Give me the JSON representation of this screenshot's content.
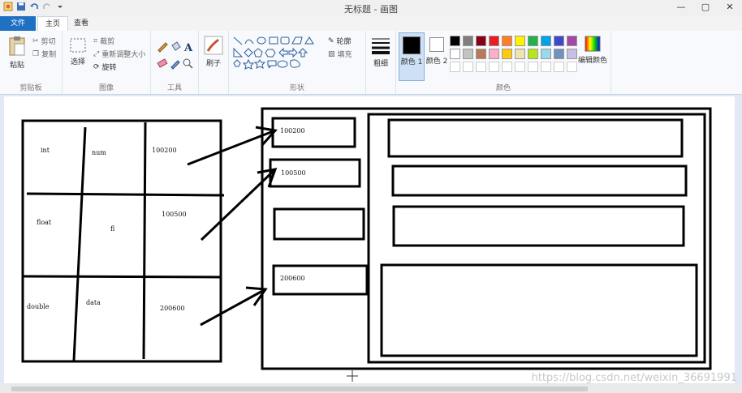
{
  "window": {
    "title": "无标题 - 画图",
    "minimize": "—",
    "maximize": "▢",
    "close": "✕"
  },
  "tabs": {
    "file": "文件",
    "home": "主页",
    "view": "查看"
  },
  "clipboard": {
    "paste": "粘贴",
    "cut": "剪切",
    "copy": "复制",
    "label": "剪贴板"
  },
  "image": {
    "select": "选择",
    "crop": "裁剪",
    "resize": "重新调整大小",
    "rotate": "旋转",
    "label": "图像"
  },
  "tools": {
    "label": "工具"
  },
  "brushes": {
    "label": "刷子"
  },
  "shapes": {
    "outline": "轮廓",
    "fill": "填充",
    "label": "形状"
  },
  "size": {
    "label": "粗细"
  },
  "colors": {
    "color1": "颜色 1",
    "color2": "颜色 2",
    "edit": "编辑颜色",
    "label": "颜色",
    "palette_row1": [
      "#000000",
      "#7f7f7f",
      "#880015",
      "#ed1c24",
      "#ff7f27",
      "#fff200",
      "#22b14c",
      "#00a2e8",
      "#3f48cc",
      "#a349a4"
    ],
    "palette_row2": [
      "#ffffff",
      "#c3c3c3",
      "#b97a57",
      "#ffaec9",
      "#ffc90e",
      "#efe4b0",
      "#b5e61d",
      "#99d9ea",
      "#7092be",
      "#c8bfe7"
    ]
  },
  "drawing": {
    "table": {
      "row1": [
        "int",
        "num",
        "100200"
      ],
      "row2": [
        "float",
        "fl",
        "100500"
      ],
      "row3": [
        "double",
        "data",
        "200600"
      ]
    },
    "pointers": [
      "100200",
      "100500",
      "",
      "200600"
    ]
  },
  "watermark": "https://blog.csdn.net/weixin_36691991"
}
